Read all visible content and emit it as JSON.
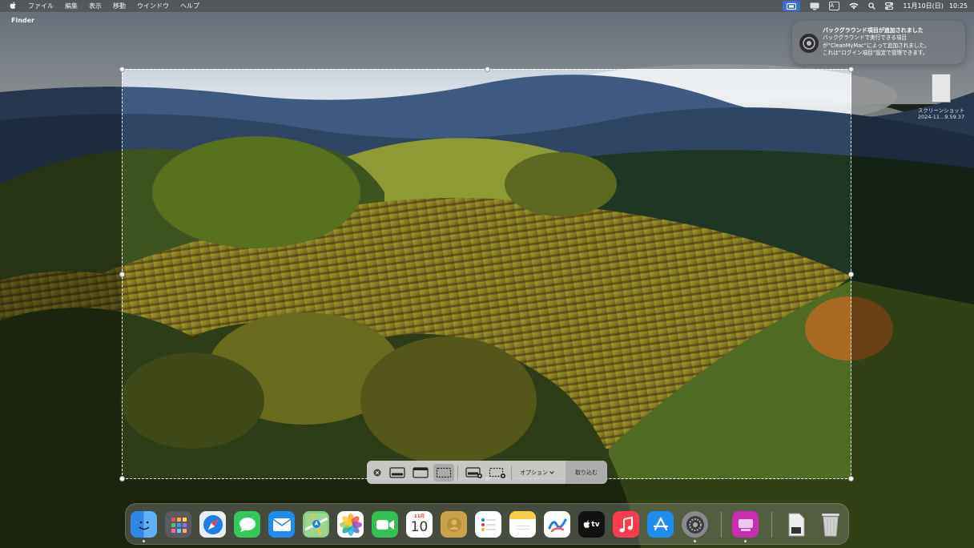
{
  "menubar": {
    "app_name": "Finder",
    "menus": [
      "ファイル",
      "編集",
      "表示",
      "移動",
      "ウインドウ",
      "ヘルプ"
    ],
    "input_mode": "A",
    "date": "11月10日(日)",
    "time": "10:25"
  },
  "notification": {
    "title": "バックグラウンド項目が追加されました",
    "body": "バックグラウンドで実行できる項目\nが“CleanMyMac”によって追加されました。\nこれは“ログイン項目”設定で管理できます。"
  },
  "desktop_file": {
    "name_line1": "スクリーンショット",
    "name_line2": "2024-11...9.59.37"
  },
  "toolbar": {
    "options_label": "オプション",
    "capture_label": "取り込む"
  },
  "dock": {
    "calendar_month": "11月",
    "calendar_day": "10",
    "tv_label": "tv"
  },
  "colors": {
    "accent": "#3a6fd8",
    "toolbar_bg": "#d2d2d2"
  }
}
